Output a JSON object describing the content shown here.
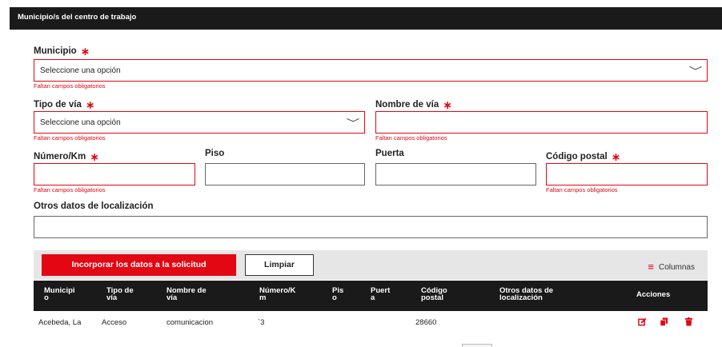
{
  "section": {
    "title": "Municipio/s del centro de trabajo"
  },
  "form": {
    "municipio": {
      "label": "Municipio",
      "required_mark": "∗",
      "placeholder": "Seleccione una opción",
      "error": "Faltan campos obligatorios"
    },
    "tipo_via": {
      "label": "Tipo de vía",
      "required_mark": "∗",
      "placeholder": "Seleccione una opción",
      "error": "Faltan campos obligatorios"
    },
    "nombre_via": {
      "label": "Nombre de vía",
      "required_mark": "∗",
      "value": "",
      "error": "Faltan campos obligatorios"
    },
    "numero_km": {
      "label": "Número/Km",
      "required_mark": "∗",
      "value": "",
      "error": "Faltan campos obligatorios"
    },
    "piso": {
      "label": "Piso",
      "value": ""
    },
    "puerta": {
      "label": "Puerta",
      "value": ""
    },
    "codigo_postal": {
      "label": "Código postal",
      "required_mark": "∗",
      "value": "",
      "error": "Faltan campos obligatorios"
    },
    "otros_datos": {
      "label": "Otros datos de localización",
      "value": ""
    }
  },
  "toolbar": {
    "primary_label": "Incorporar los datos a la solicitud",
    "clear_label": "Limpiar",
    "columns_label": "Columnas",
    "columns_icon": "list-icon"
  },
  "table": {
    "headers": [
      "Municipi\no",
      "Tipo de\nvía",
      "Nombre de\nvía",
      "Número/K\nm",
      "Pis\no",
      "Puert\na",
      "Código\npostal",
      "Otros datos de\nlocalización",
      "Acciones"
    ],
    "rows": [
      {
        "municipio": "Acebeda, La",
        "tipo_via": "Acceso",
        "nombre_via": "comunicacion",
        "numero": "`3",
        "piso": "",
        "puerta": "",
        "codigo_postal": "28660",
        "otros": ""
      }
    ],
    "action_icons": [
      "edit-icon",
      "copy-icon",
      "delete-icon"
    ]
  },
  "colors": {
    "accent": "#e30613",
    "header_bg": "#1a1a1a",
    "toolbar_bg": "#e6e6e6"
  }
}
